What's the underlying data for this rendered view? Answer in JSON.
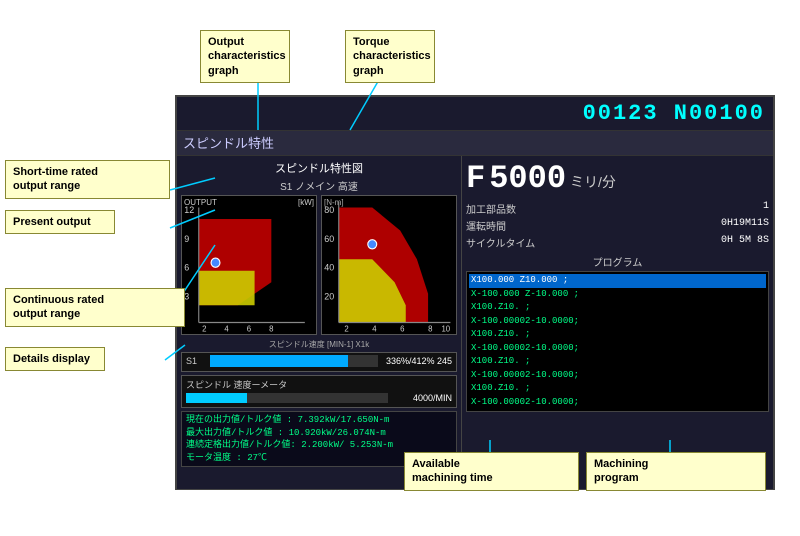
{
  "screen": {
    "program_id": "00123 N00100",
    "title": "スピンドル特性",
    "graph_title": "スピンドル特性図",
    "graph_subtitle": "S1 ノメイン 高速",
    "graph_left_label": "OUTPUT",
    "graph_left_unit": "[kW]",
    "graph_right_label": "",
    "graph_right_unit": "[N-m]",
    "speed_axis": "スピンドル速度 [MIN-1] X1k",
    "f_label": "F",
    "f_value": "5000",
    "f_unit": "ミリ/分",
    "info": {
      "parts_label": "加工部品数",
      "parts_value": "1",
      "run_time_label": "運転時間",
      "run_time_value": "0H19M11S",
      "cycle_label": "サイクルタイム",
      "cycle_value": "0H 5M 8S"
    },
    "program_section_label": "プログラム",
    "program_lines": [
      {
        "text": "X100.000 Z10.000 ;",
        "active": true
      },
      {
        "text": "X-100.000 Z-10.000 ;",
        "active": false
      },
      {
        "text": "X100.Z10. ;",
        "active": false
      },
      {
        "text": "X-100.00002-10.0000;",
        "active": false
      },
      {
        "text": "X100.Z10. ;",
        "active": false
      },
      {
        "text": "X-100.00002-10.0000;",
        "active": false
      },
      {
        "text": "X100.Z10. ;",
        "active": false
      },
      {
        "text": "X-100.00002-10.0000;",
        "active": false
      },
      {
        "text": "X100.Z10. ;",
        "active": false
      },
      {
        "text": "X-100.00002-10.0000;",
        "active": false
      }
    ],
    "speed_bar": {
      "label": "S1",
      "bar_percent": 82,
      "bar_text": "336%/412%  245"
    },
    "meter": {
      "title": "スピンドル 速度ーメータ",
      "value": "4000/MIN"
    },
    "details": [
      "現在の出力値/トルク値  :  7.392kW/17.650N-m",
      "最大出力値/トルク値   : 10.920kW/26.074N-m",
      "連続定格出力値/トルク値:  2.200kW/  5.253N-m",
      "モータ温度           :  27℃"
    ]
  },
  "callouts": {
    "output_graph": "Output\ncharacteristics\ngraph",
    "torque_graph": "Torque\ncharacteristics\ngraph",
    "short_time": "Short-time rated\noutput range",
    "present_output": "Present  output",
    "continuous": "Continuous rated\noutput range",
    "details": "Details display",
    "available_time": "Available\nmachining time",
    "machining_program": "Machining\nprogram"
  }
}
